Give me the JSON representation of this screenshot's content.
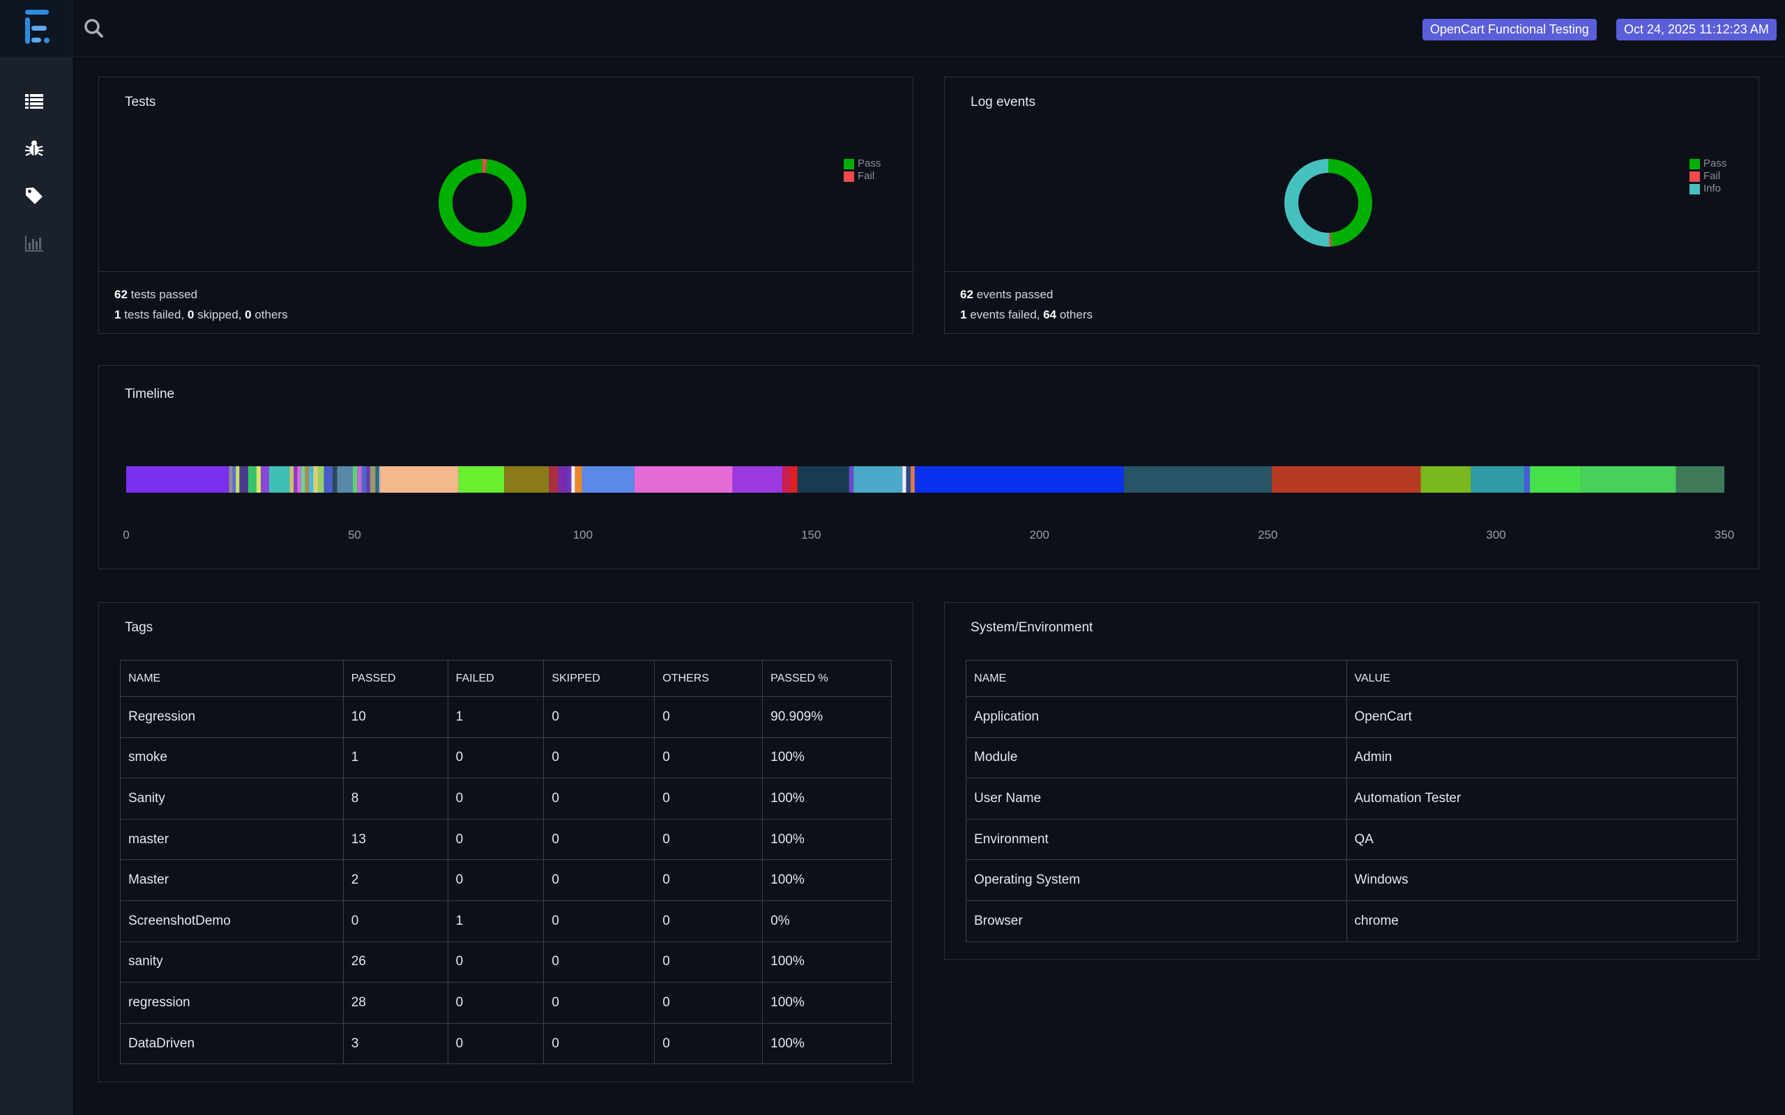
{
  "header": {
    "report_name": "OpenCart Functional Testing",
    "timestamp": "Oct 24, 2025 11:12:23 AM"
  },
  "sidebar": {
    "items": [
      {
        "name": "dashboard-list-icon"
      },
      {
        "name": "bug-icon"
      },
      {
        "name": "tag-icon"
      },
      {
        "name": "bar-chart-icon"
      }
    ]
  },
  "colors": {
    "pass": "#00b000",
    "fail": "#f04a4a",
    "info": "#47c1c0",
    "pill": "#5b5ed9",
    "accent_logo": "#2d8ae0"
  },
  "tests": {
    "title": "Tests",
    "legend": [
      "Pass",
      "Fail"
    ],
    "passed": 62,
    "failed": 1,
    "skipped": 0,
    "others": 0,
    "passed_text": " tests passed",
    "failed_text": " tests failed, ",
    "skipped_text": " skipped, ",
    "others_text": " others"
  },
  "log_events": {
    "title": "Log events",
    "legend": [
      "Pass",
      "Fail",
      "Info"
    ],
    "passed": 62,
    "failed": 1,
    "others": 64,
    "passed_text": " events passed",
    "failed_text": " events failed, ",
    "others_text": " others"
  },
  "timeline": {
    "title": "Timeline",
    "ticks": [
      "0",
      "50",
      "100",
      "150",
      "200",
      "250",
      "300",
      "350"
    ],
    "max": 350,
    "segments": [
      {
        "start": 0,
        "end": 22.5,
        "color": "#7b2ff0"
      },
      {
        "start": 22.5,
        "end": 23.3,
        "color": "#8f8f8f"
      },
      {
        "start": 23.3,
        "end": 24.0,
        "color": "#5a6cd8"
      },
      {
        "start": 24.0,
        "end": 24.8,
        "color": "#c8e070"
      },
      {
        "start": 24.8,
        "end": 26.7,
        "color": "#4a3a8a"
      },
      {
        "start": 26.7,
        "end": 28.5,
        "color": "#36c46a"
      },
      {
        "start": 28.5,
        "end": 29.5,
        "color": "#d6e36a"
      },
      {
        "start": 29.5,
        "end": 31.3,
        "color": "#8b47d6"
      },
      {
        "start": 31.3,
        "end": 35.8,
        "color": "#3fbfb4"
      },
      {
        "start": 35.8,
        "end": 36.7,
        "color": "#d0c26a"
      },
      {
        "start": 36.7,
        "end": 37.5,
        "color": "#8a3ad0"
      },
      {
        "start": 37.5,
        "end": 38.3,
        "color": "#e26ad6"
      },
      {
        "start": 38.3,
        "end": 39.2,
        "color": "#6ad69a"
      },
      {
        "start": 39.2,
        "end": 40.0,
        "color": "#b08a4a"
      },
      {
        "start": 40.0,
        "end": 41.0,
        "color": "#4ab8d8"
      },
      {
        "start": 41.0,
        "end": 42.0,
        "color": "#e0d070"
      },
      {
        "start": 42.0,
        "end": 43.3,
        "color": "#9ad06a"
      },
      {
        "start": 43.3,
        "end": 45.2,
        "color": "#4b5bc8"
      },
      {
        "start": 45.2,
        "end": 46.2,
        "color": "#2c4a5a"
      },
      {
        "start": 46.2,
        "end": 49.6,
        "color": "#5a88a8"
      },
      {
        "start": 49.6,
        "end": 50.6,
        "color": "#5ed07a"
      },
      {
        "start": 50.6,
        "end": 51.6,
        "color": "#c46ad6"
      },
      {
        "start": 51.6,
        "end": 52.6,
        "color": "#4a6acd"
      },
      {
        "start": 52.6,
        "end": 53.4,
        "color": "#6a3ab0"
      },
      {
        "start": 53.4,
        "end": 54.6,
        "color": "#9a9a6a"
      },
      {
        "start": 54.6,
        "end": 55.4,
        "color": "#2d6a8a"
      },
      {
        "start": 55.4,
        "end": 55.7,
        "color": "#c8c8c8"
      },
      {
        "start": 55.7,
        "end": 72.8,
        "color": "#f4b88a"
      },
      {
        "start": 72.8,
        "end": 82.8,
        "color": "#6aee30"
      },
      {
        "start": 82.8,
        "end": 92.6,
        "color": "#8a7a1a"
      },
      {
        "start": 92.6,
        "end": 94.6,
        "color": "#a83040"
      },
      {
        "start": 94.6,
        "end": 96.4,
        "color": "#7a2ab0"
      },
      {
        "start": 96.4,
        "end": 97.5,
        "color": "#6a3ab8"
      },
      {
        "start": 97.5,
        "end": 98.3,
        "color": "#f0f0f0"
      },
      {
        "start": 98.3,
        "end": 99.8,
        "color": "#f0862a"
      },
      {
        "start": 99.8,
        "end": 111.3,
        "color": "#5b8ae8"
      },
      {
        "start": 111.3,
        "end": 132.8,
        "color": "#e46ad8"
      },
      {
        "start": 132.8,
        "end": 143.7,
        "color": "#9a3ae0"
      },
      {
        "start": 143.7,
        "end": 145.5,
        "color": "#c81e50"
      },
      {
        "start": 145.5,
        "end": 147.0,
        "color": "#e0201e"
      },
      {
        "start": 147.0,
        "end": 158.3,
        "color": "#1a3a52"
      },
      {
        "start": 158.3,
        "end": 159.3,
        "color": "#6a4ac8"
      },
      {
        "start": 159.3,
        "end": 170.0,
        "color": "#4aa8c8"
      },
      {
        "start": 170.0,
        "end": 170.8,
        "color": "#f0f0f0"
      },
      {
        "start": 170.8,
        "end": 171.8,
        "color": "#2a4a8a"
      },
      {
        "start": 171.8,
        "end": 172.7,
        "color": "#e07a4a"
      },
      {
        "start": 172.7,
        "end": 218.5,
        "color": "#0a30f0"
      },
      {
        "start": 218.5,
        "end": 250.9,
        "color": "#275566"
      },
      {
        "start": 250.9,
        "end": 283.5,
        "color": "#b83a22"
      },
      {
        "start": 283.5,
        "end": 294.5,
        "color": "#7ab81e"
      },
      {
        "start": 294.5,
        "end": 306.2,
        "color": "#2e9aa6"
      },
      {
        "start": 306.2,
        "end": 307.4,
        "color": "#4a5ae0"
      },
      {
        "start": 307.4,
        "end": 318.6,
        "color": "#46e04a"
      },
      {
        "start": 318.6,
        "end": 339.4,
        "color": "#46d25a"
      },
      {
        "start": 339.4,
        "end": 350.0,
        "color": "#3f7a5a"
      }
    ]
  },
  "tags": {
    "title": "Tags",
    "headers": [
      "NAME",
      "PASSED",
      "FAILED",
      "SKIPPED",
      "OTHERS",
      "PASSED %"
    ],
    "rows": [
      [
        "Regression",
        "10",
        "1",
        "0",
        "0",
        "90.909%"
      ],
      [
        "smoke",
        "1",
        "0",
        "0",
        "0",
        "100%"
      ],
      [
        "Sanity",
        "8",
        "0",
        "0",
        "0",
        "100%"
      ],
      [
        "master",
        "13",
        "0",
        "0",
        "0",
        "100%"
      ],
      [
        "Master",
        "2",
        "0",
        "0",
        "0",
        "100%"
      ],
      [
        "ScreenshotDemo",
        "0",
        "1",
        "0",
        "0",
        "0%"
      ],
      [
        "sanity",
        "26",
        "0",
        "0",
        "0",
        "100%"
      ],
      [
        "regression",
        "28",
        "0",
        "0",
        "0",
        "100%"
      ],
      [
        "DataDriven",
        "3",
        "0",
        "0",
        "0",
        "100%"
      ]
    ]
  },
  "system": {
    "title": "System/Environment",
    "headers": [
      "NAME",
      "VALUE"
    ],
    "rows": [
      [
        "Application",
        "OpenCart"
      ],
      [
        "Module",
        "Admin"
      ],
      [
        "User Name",
        "Automation Tester"
      ],
      [
        "Environment",
        "QA"
      ],
      [
        "Operating System",
        "Windows"
      ],
      [
        "Browser",
        "chrome"
      ]
    ]
  }
}
